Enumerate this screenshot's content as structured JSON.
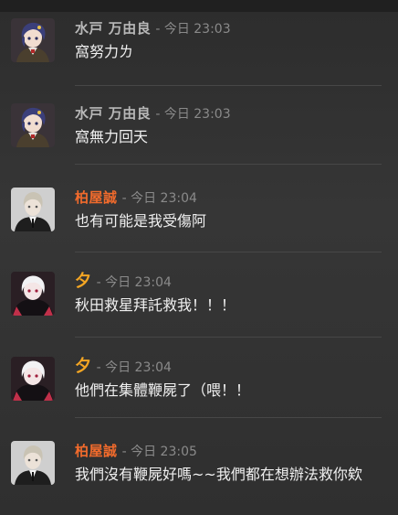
{
  "colors": {
    "name_gray": "#b8b8b8",
    "name_orange": "#f26b2c",
    "name_yellow": "#f5a623",
    "timestamp": "#8a8a8a",
    "message_text": "#f0f0f0"
  },
  "messages": [
    {
      "author": "水戸 万由良",
      "timestamp": "- 今日 23:03",
      "text": "窩努力ㄌ",
      "avatar_icon": "user-avatar-mito"
    },
    {
      "author": "水戸 万由良",
      "timestamp": "- 今日 23:03",
      "text": "窩無力回天",
      "avatar_icon": "user-avatar-mito"
    },
    {
      "author": "柏屋誠",
      "timestamp": "- 今日 23:04",
      "text": "也有可能是我受傷阿",
      "avatar_icon": "user-avatar-kashiya"
    },
    {
      "author": "夕",
      "timestamp": "- 今日 23:04",
      "text": "秋田救星拜託救我！！！",
      "avatar_icon": "user-avatar-yu"
    },
    {
      "author": "夕",
      "timestamp": "- 今日 23:04",
      "text": "他們在集體鞭屍了（喂！！",
      "avatar_icon": "user-avatar-yu"
    },
    {
      "author": "柏屋誠",
      "timestamp": "- 今日 23:05",
      "text": "我們沒有鞭屍好嗎~~我們都在想辦法救你欸",
      "avatar_icon": "user-avatar-kashiya"
    }
  ]
}
